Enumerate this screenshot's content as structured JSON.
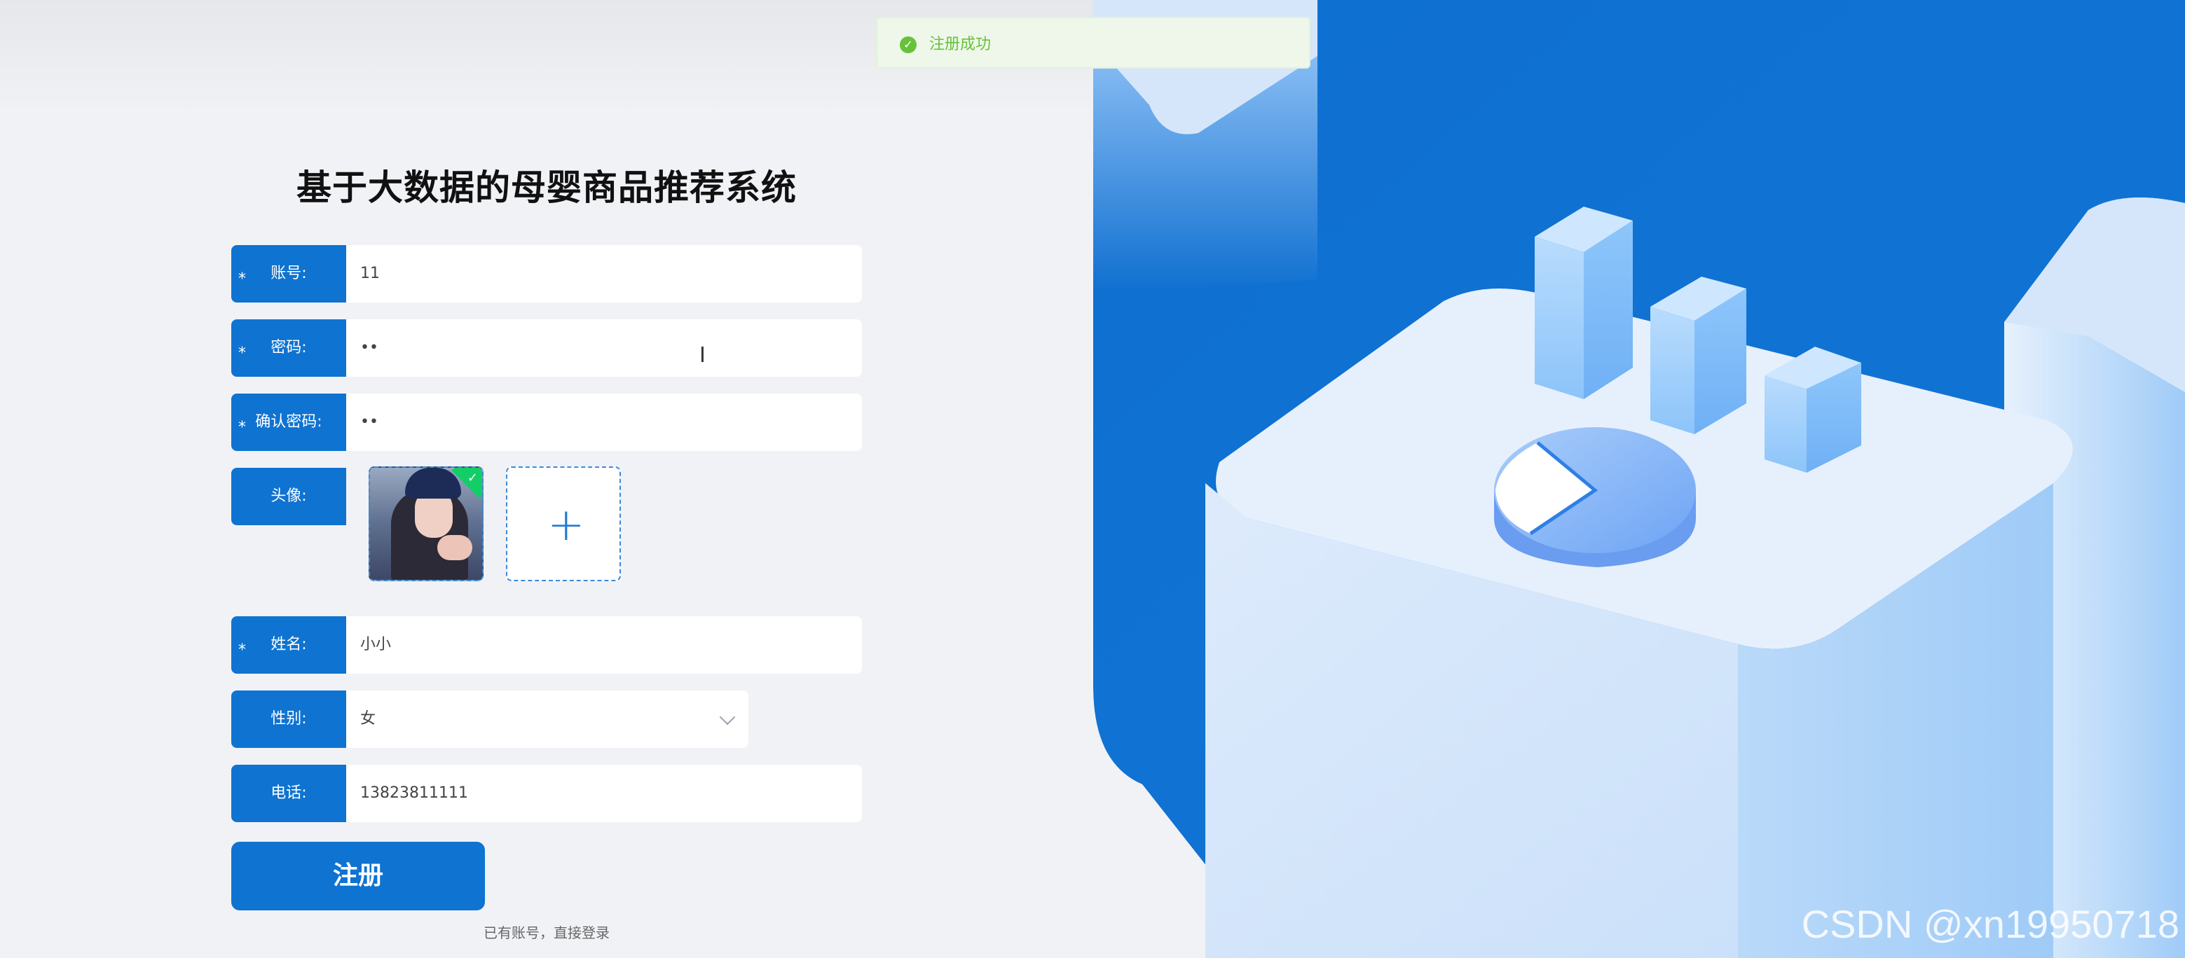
{
  "title": "基于大数据的母婴商品推荐系统",
  "toast": {
    "icon": "check-circle-icon",
    "message": "注册成功"
  },
  "form": {
    "account": {
      "label": "账号:",
      "value": "11",
      "required": "*"
    },
    "password": {
      "label": "密码:",
      "value": "••",
      "required": "*"
    },
    "confirm": {
      "label": "确认密码:",
      "value": "••",
      "required": "*"
    },
    "avatar": {
      "label": "头像:",
      "upload_icon": "plus-icon"
    },
    "name": {
      "label": "姓名:",
      "value": "小小",
      "required": "*"
    },
    "gender": {
      "label": "性别:",
      "value": "女"
    },
    "phone": {
      "label": "电话:",
      "value": "13823811111"
    }
  },
  "submit_label": "注册",
  "login_link": "已有账号，直接登录",
  "watermark": "CSDN @xn19950718",
  "colors": {
    "primary": "#0f73d1",
    "success": "#67c23a",
    "background": "#f1f2f6"
  }
}
